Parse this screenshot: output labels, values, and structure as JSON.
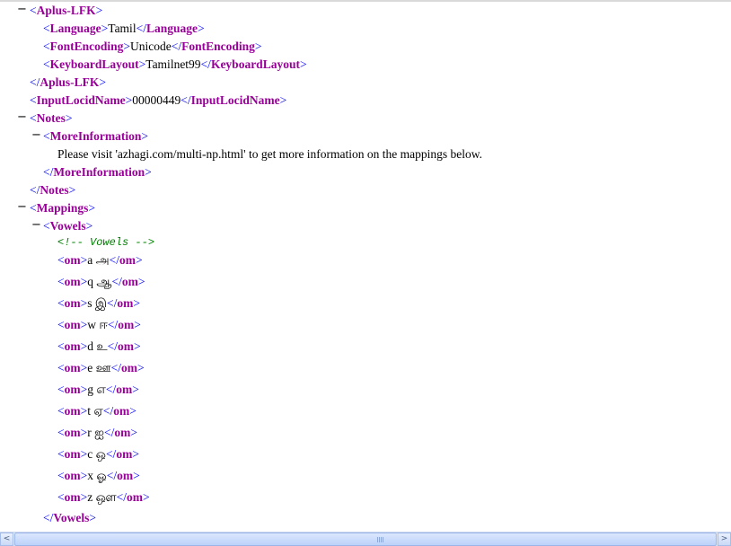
{
  "xml": {
    "aplus_lfk": "Aplus-LFK",
    "language_tag": "Language",
    "language_value": "Tamil",
    "fontencoding_tag": "FontEncoding",
    "fontencoding_value": "Unicode",
    "keyboardlayout_tag": "KeyboardLayout",
    "keyboardlayout_value": "Tamilnet99",
    "inputlocid_tag": "InputLocidName",
    "inputlocid_value": "00000449",
    "notes_tag": "Notes",
    "moreinfo_tag": "MoreInformation",
    "moreinfo_text": "Please visit 'azhagi.com/multi-np.html' to get more information on the mappings below.",
    "mappings_tag": "Mappings",
    "vowels_tag": "Vowels",
    "vowels_comment": "<!-- Vowels -->",
    "om_tag": "om",
    "om_entries": [
      "a அ",
      "q ஆ",
      "s இ",
      "w ஈ",
      "d உ",
      "e ஊ",
      "g எ",
      "t ஏ",
      "r ஐ",
      "c ஒ",
      "x ஓ",
      "z ஔ"
    ]
  },
  "scrollbar": {
    "left_arrow": "<",
    "right_arrow": ">"
  }
}
